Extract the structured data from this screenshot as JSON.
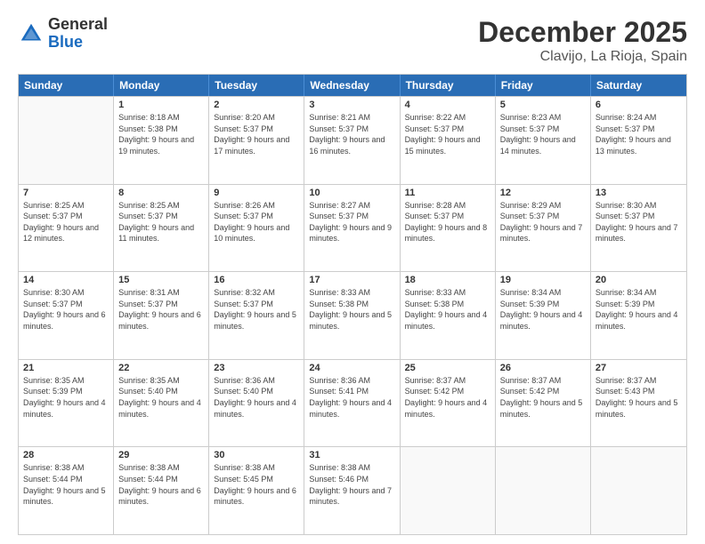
{
  "logo": {
    "general": "General",
    "blue": "Blue"
  },
  "title": "December 2025",
  "location": "Clavijo, La Rioja, Spain",
  "days_header": [
    "Sunday",
    "Monday",
    "Tuesday",
    "Wednesday",
    "Thursday",
    "Friday",
    "Saturday"
  ],
  "weeks": [
    [
      {
        "day": "",
        "sunrise": "",
        "sunset": "",
        "daylight": ""
      },
      {
        "day": "1",
        "sunrise": "Sunrise: 8:18 AM",
        "sunset": "Sunset: 5:38 PM",
        "daylight": "Daylight: 9 hours and 19 minutes."
      },
      {
        "day": "2",
        "sunrise": "Sunrise: 8:20 AM",
        "sunset": "Sunset: 5:37 PM",
        "daylight": "Daylight: 9 hours and 17 minutes."
      },
      {
        "day": "3",
        "sunrise": "Sunrise: 8:21 AM",
        "sunset": "Sunset: 5:37 PM",
        "daylight": "Daylight: 9 hours and 16 minutes."
      },
      {
        "day": "4",
        "sunrise": "Sunrise: 8:22 AM",
        "sunset": "Sunset: 5:37 PM",
        "daylight": "Daylight: 9 hours and 15 minutes."
      },
      {
        "day": "5",
        "sunrise": "Sunrise: 8:23 AM",
        "sunset": "Sunset: 5:37 PM",
        "daylight": "Daylight: 9 hours and 14 minutes."
      },
      {
        "day": "6",
        "sunrise": "Sunrise: 8:24 AM",
        "sunset": "Sunset: 5:37 PM",
        "daylight": "Daylight: 9 hours and 13 minutes."
      }
    ],
    [
      {
        "day": "7",
        "sunrise": "Sunrise: 8:25 AM",
        "sunset": "Sunset: 5:37 PM",
        "daylight": "Daylight: 9 hours and 12 minutes."
      },
      {
        "day": "8",
        "sunrise": "Sunrise: 8:25 AM",
        "sunset": "Sunset: 5:37 PM",
        "daylight": "Daylight: 9 hours and 11 minutes."
      },
      {
        "day": "9",
        "sunrise": "Sunrise: 8:26 AM",
        "sunset": "Sunset: 5:37 PM",
        "daylight": "Daylight: 9 hours and 10 minutes."
      },
      {
        "day": "10",
        "sunrise": "Sunrise: 8:27 AM",
        "sunset": "Sunset: 5:37 PM",
        "daylight": "Daylight: 9 hours and 9 minutes."
      },
      {
        "day": "11",
        "sunrise": "Sunrise: 8:28 AM",
        "sunset": "Sunset: 5:37 PM",
        "daylight": "Daylight: 9 hours and 8 minutes."
      },
      {
        "day": "12",
        "sunrise": "Sunrise: 8:29 AM",
        "sunset": "Sunset: 5:37 PM",
        "daylight": "Daylight: 9 hours and 7 minutes."
      },
      {
        "day": "13",
        "sunrise": "Sunrise: 8:30 AM",
        "sunset": "Sunset: 5:37 PM",
        "daylight": "Daylight: 9 hours and 7 minutes."
      }
    ],
    [
      {
        "day": "14",
        "sunrise": "Sunrise: 8:30 AM",
        "sunset": "Sunset: 5:37 PM",
        "daylight": "Daylight: 9 hours and 6 minutes."
      },
      {
        "day": "15",
        "sunrise": "Sunrise: 8:31 AM",
        "sunset": "Sunset: 5:37 PM",
        "daylight": "Daylight: 9 hours and 6 minutes."
      },
      {
        "day": "16",
        "sunrise": "Sunrise: 8:32 AM",
        "sunset": "Sunset: 5:37 PM",
        "daylight": "Daylight: 9 hours and 5 minutes."
      },
      {
        "day": "17",
        "sunrise": "Sunrise: 8:33 AM",
        "sunset": "Sunset: 5:38 PM",
        "daylight": "Daylight: 9 hours and 5 minutes."
      },
      {
        "day": "18",
        "sunrise": "Sunrise: 8:33 AM",
        "sunset": "Sunset: 5:38 PM",
        "daylight": "Daylight: 9 hours and 4 minutes."
      },
      {
        "day": "19",
        "sunrise": "Sunrise: 8:34 AM",
        "sunset": "Sunset: 5:39 PM",
        "daylight": "Daylight: 9 hours and 4 minutes."
      },
      {
        "day": "20",
        "sunrise": "Sunrise: 8:34 AM",
        "sunset": "Sunset: 5:39 PM",
        "daylight": "Daylight: 9 hours and 4 minutes."
      }
    ],
    [
      {
        "day": "21",
        "sunrise": "Sunrise: 8:35 AM",
        "sunset": "Sunset: 5:39 PM",
        "daylight": "Daylight: 9 hours and 4 minutes."
      },
      {
        "day": "22",
        "sunrise": "Sunrise: 8:35 AM",
        "sunset": "Sunset: 5:40 PM",
        "daylight": "Daylight: 9 hours and 4 minutes."
      },
      {
        "day": "23",
        "sunrise": "Sunrise: 8:36 AM",
        "sunset": "Sunset: 5:40 PM",
        "daylight": "Daylight: 9 hours and 4 minutes."
      },
      {
        "day": "24",
        "sunrise": "Sunrise: 8:36 AM",
        "sunset": "Sunset: 5:41 PM",
        "daylight": "Daylight: 9 hours and 4 minutes."
      },
      {
        "day": "25",
        "sunrise": "Sunrise: 8:37 AM",
        "sunset": "Sunset: 5:42 PM",
        "daylight": "Daylight: 9 hours and 4 minutes."
      },
      {
        "day": "26",
        "sunrise": "Sunrise: 8:37 AM",
        "sunset": "Sunset: 5:42 PM",
        "daylight": "Daylight: 9 hours and 5 minutes."
      },
      {
        "day": "27",
        "sunrise": "Sunrise: 8:37 AM",
        "sunset": "Sunset: 5:43 PM",
        "daylight": "Daylight: 9 hours and 5 minutes."
      }
    ],
    [
      {
        "day": "28",
        "sunrise": "Sunrise: 8:38 AM",
        "sunset": "Sunset: 5:44 PM",
        "daylight": "Daylight: 9 hours and 5 minutes."
      },
      {
        "day": "29",
        "sunrise": "Sunrise: 8:38 AM",
        "sunset": "Sunset: 5:44 PM",
        "daylight": "Daylight: 9 hours and 6 minutes."
      },
      {
        "day": "30",
        "sunrise": "Sunrise: 8:38 AM",
        "sunset": "Sunset: 5:45 PM",
        "daylight": "Daylight: 9 hours and 6 minutes."
      },
      {
        "day": "31",
        "sunrise": "Sunrise: 8:38 AM",
        "sunset": "Sunset: 5:46 PM",
        "daylight": "Daylight: 9 hours and 7 minutes."
      },
      {
        "day": "",
        "sunrise": "",
        "sunset": "",
        "daylight": ""
      },
      {
        "day": "",
        "sunrise": "",
        "sunset": "",
        "daylight": ""
      },
      {
        "day": "",
        "sunrise": "",
        "sunset": "",
        "daylight": ""
      }
    ]
  ]
}
